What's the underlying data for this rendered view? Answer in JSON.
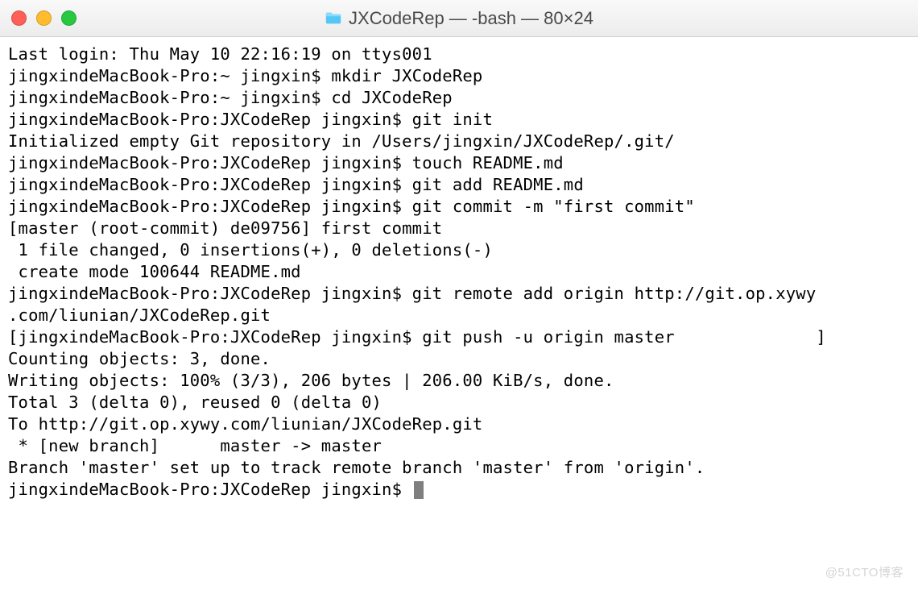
{
  "window": {
    "title": "JXCodeRep — -bash — 80×24"
  },
  "traffic_lights": {
    "close": "close",
    "minimize": "minimize",
    "zoom": "zoom"
  },
  "terminal": {
    "lines": [
      "Last login: Thu May 10 22:16:19 on ttys001",
      "jingxindeMacBook-Pro:~ jingxin$ mkdir JXCodeRep",
      "jingxindeMacBook-Pro:~ jingxin$ cd JXCodeRep",
      "jingxindeMacBook-Pro:JXCodeRep jingxin$ git init",
      "Initialized empty Git repository in /Users/jingxin/JXCodeRep/.git/",
      "jingxindeMacBook-Pro:JXCodeRep jingxin$ touch README.md",
      "jingxindeMacBook-Pro:JXCodeRep jingxin$ git add README.md",
      "jingxindeMacBook-Pro:JXCodeRep jingxin$ git commit -m \"first commit\"",
      "[master (root-commit) de09756] first commit",
      " 1 file changed, 0 insertions(+), 0 deletions(-)",
      " create mode 100644 README.md",
      "jingxindeMacBook-Pro:JXCodeRep jingxin$ git remote add origin http://git.op.xywy",
      ".com/liunian/JXCodeRep.git",
      "[jingxindeMacBook-Pro:JXCodeRep jingxin$ git push -u origin master              ]",
      "Counting objects: 3, done.",
      "Writing objects: 100% (3/3), 206 bytes | 206.00 KiB/s, done.",
      "Total 3 (delta 0), reused 0 (delta 0)",
      "To http://git.op.xywy.com/liunian/JXCodeRep.git",
      " * [new branch]      master -> master",
      "Branch 'master' set up to track remote branch 'master' from 'origin'.",
      "jingxindeMacBook-Pro:JXCodeRep jingxin$ "
    ]
  },
  "watermark": "@51CTO博客"
}
